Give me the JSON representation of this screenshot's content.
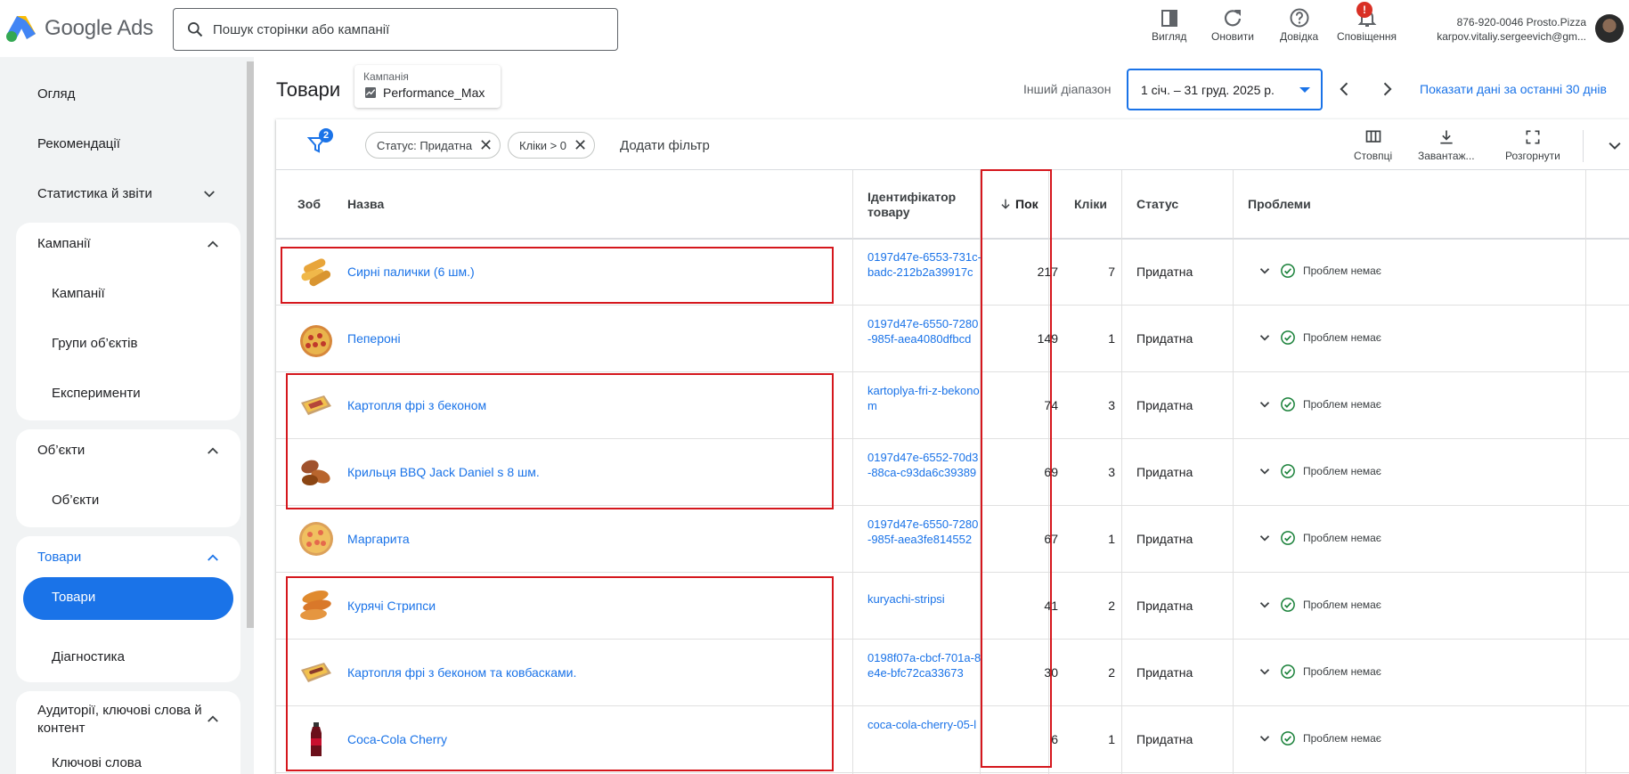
{
  "header": {
    "logo_text": "Google Ads",
    "search_placeholder": "Пошук сторінки або кампанії",
    "buttons": [
      {
        "label": "Вигляд",
        "icon": "appearance-icon"
      },
      {
        "label": "Оновити",
        "icon": "refresh-icon"
      },
      {
        "label": "Довідка",
        "icon": "help-icon"
      },
      {
        "label": "Сповіщення",
        "icon": "bell-icon",
        "badge": "!"
      }
    ],
    "account_line1": "876-920-0046 Prosto.Pizza",
    "account_line2": "karpov.vitaliy.sergeevich@gm..."
  },
  "sidebar": {
    "top_items": [
      "Огляд",
      "Рекомендації",
      "Статистика й звіти"
    ],
    "groups": [
      {
        "title": "Кампанії",
        "items": [
          "Кампанії",
          "Групи об’єктів",
          "Експерименти"
        ]
      },
      {
        "title": "Об’єкти",
        "items": [
          "Об’єкти"
        ]
      },
      {
        "title": "Товари",
        "items": [
          "Товари",
          "Діагностика"
        ],
        "active": "Товари"
      },
      {
        "title": "Аудиторії, ключові слова й контент",
        "items": [
          "Ключові слова"
        ]
      }
    ]
  },
  "main": {
    "title": "Товари",
    "campaign_label": "Кампанія",
    "campaign_value": "Performance_Max",
    "range_label": "Інший діапазон",
    "date_range": "1 січ. – 31 груд. 2025 р.",
    "last30": "Показати дані за останні 30 днів"
  },
  "toolbar": {
    "filter_count": "2",
    "chips": [
      "Статус: Придатна",
      "Кліки > 0"
    ],
    "add_filter": "Додати фільтр",
    "tools": [
      {
        "label": "Стовпці",
        "icon": "columns-icon"
      },
      {
        "label": "Завантаж...",
        "icon": "download-icon"
      },
      {
        "label": "Розгорнути",
        "icon": "expand-icon"
      }
    ]
  },
  "table": {
    "headers": {
      "image": "Зоб",
      "name": "Назва",
      "id": "Ідентифікатор товару",
      "impressions": "Пок",
      "clicks": "Кліки",
      "status": "Статус",
      "issues": "Проблеми"
    },
    "rows": [
      {
        "name": "Сирні палички (6 шм.)",
        "id": "0197d47e-6553-731c-badc-212b2a39917c",
        "impressions": "217",
        "clicks": "7",
        "status": "Придатна",
        "issues": "Проблем немає",
        "thumb": "cheese-sticks-image"
      },
      {
        "name": "Пепероні",
        "id": "0197d47e-6550-7280-985f-aea4080dfbcd",
        "impressions": "149",
        "clicks": "1",
        "status": "Придатна",
        "issues": "Проблем немає",
        "thumb": "pepperoni-pizza-image"
      },
      {
        "name": "Картопля фрі з беконом",
        "id": "kartoplya-fri-z-bekonom",
        "impressions": "74",
        "clicks": "3",
        "status": "Придатна",
        "issues": "Проблем немає",
        "thumb": "fries-bacon-image"
      },
      {
        "name": "Крильця BBQ Jack Daniel s 8 шм.",
        "id": "0197d47e-6552-70d3-88ca-c93da6c39389",
        "impressions": "69",
        "clicks": "3",
        "status": "Придатна",
        "issues": "Проблем немає",
        "thumb": "bbq-wings-image"
      },
      {
        "name": "Маргарита",
        "id": "0197d47e-6550-7280-985f-aea3fe814552",
        "impressions": "67",
        "clicks": "1",
        "status": "Придатна",
        "issues": "Проблем немає",
        "thumb": "margherita-pizza-image"
      },
      {
        "name": "Курячі Стрипси",
        "id": "kuryachi-stripsi",
        "impressions": "41",
        "clicks": "2",
        "status": "Придатна",
        "issues": "Проблем немає",
        "thumb": "chicken-strips-image"
      },
      {
        "name": "Картопля фрі з беконом та ковбасками.",
        "id": "0198f07a-cbcf-701a-8e4e-bfc72ca33673",
        "impressions": "30",
        "clicks": "2",
        "status": "Придатна",
        "issues": "Проблем немає",
        "thumb": "fries-sausage-image"
      },
      {
        "name": "Coca-Cola Cherry",
        "id": "coca-cola-cherry-05-l",
        "impressions": "6",
        "clicks": "1",
        "status": "Придатна",
        "issues": "Проблем немає",
        "thumb": "coca-cola-image"
      }
    ]
  },
  "colors": {
    "accent": "#1a73e8",
    "annotation_red": "#d5171d",
    "success": "#188038"
  }
}
